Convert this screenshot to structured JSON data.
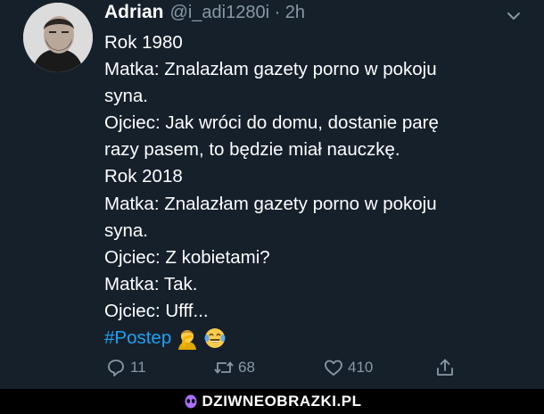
{
  "tweet": {
    "author_name": "Adrian",
    "meta": "@i_adi1280i · 2h",
    "lines": [
      "Rok 1980",
      "Matka: Znalazłam gazety porno w pokoju",
      "syna.",
      "Ojciec: Jak wróci do domu, dostanie parę",
      "razy pasem, to będzie miał nauczkę.",
      "Rok 2018",
      "Matka: Znalazłam gazety porno w pokoju",
      "syna.",
      "Ojciec: Z kobietami?",
      "Matka: Tak.",
      "Ojciec: Ufff..."
    ],
    "hashtag": "#Postep",
    "emojis": [
      "man-facepalming-emoji",
      "face-with-tears-of-joy-emoji"
    ],
    "replies": "11",
    "retweets": "68",
    "likes": "410"
  },
  "footer": {
    "brand": "DZIWNEOBRAZKI.PL"
  },
  "colors": {
    "background": "#15202b",
    "text": "#ffffff",
    "muted": "#8899a6",
    "link": "#1da1f2",
    "footer_bg": "#000000",
    "brand_icon": "#a970ff"
  }
}
